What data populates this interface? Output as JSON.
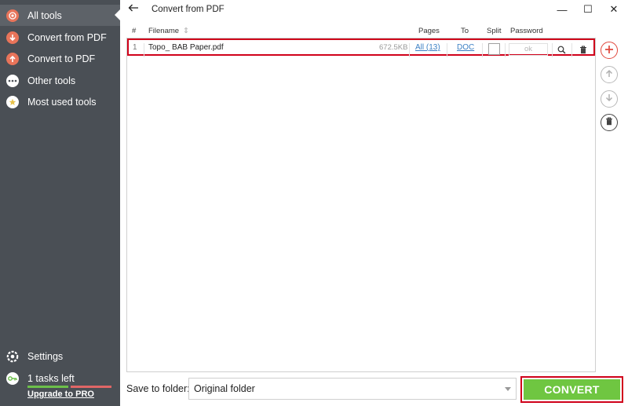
{
  "sidebar": {
    "items": [
      {
        "label": "All tools",
        "icon": "all-tools-icon",
        "active": true
      },
      {
        "label": "Convert from PDF",
        "icon": "arrow-down-icon"
      },
      {
        "label": "Convert to PDF",
        "icon": "arrow-up-icon"
      },
      {
        "label": "Other tools",
        "icon": "dots-icon"
      },
      {
        "label": "Most used tools",
        "icon": "star-icon"
      }
    ],
    "settings_label": "Settings",
    "tasks_left": "1 tasks left",
    "upgrade_label": "Upgrade to PRO"
  },
  "window": {
    "title": "Convert from PDF",
    "minimize": "—",
    "maximize": "☐",
    "close": "✕"
  },
  "table": {
    "headers": {
      "index": "#",
      "filename": "Filename",
      "filename_sort": "⇕",
      "pages": "Pages",
      "to": "To",
      "split": "Split",
      "password": "Password"
    },
    "rows": [
      {
        "index": "1",
        "filename": "Topo_ BAB Paper.pdf",
        "size": "672.5KB",
        "pages": "All (13)",
        "to": "DOC",
        "password": "ok"
      }
    ]
  },
  "footer": {
    "save_label": "Save to folder:",
    "save_value": "Original folder",
    "convert_label": "CONVERT"
  },
  "colors": {
    "accent_red": "#d0021b",
    "convert_green": "#6fc641",
    "sidebar_bg": "#4a4f55",
    "link_blue": "#3b7fc4"
  }
}
